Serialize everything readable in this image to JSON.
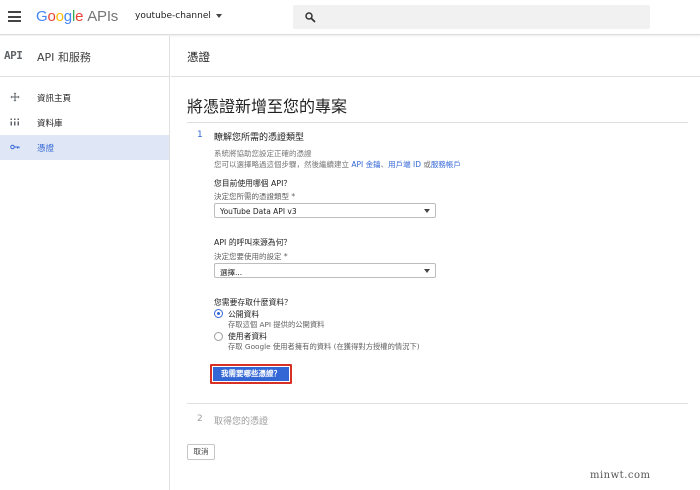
{
  "topbar": {
    "logo_letters": [
      "G",
      "o",
      "o",
      "g",
      "l",
      "e"
    ],
    "logo_suffix": "APIs",
    "project_name": "youtube-channel",
    "brand_colors": {
      "blue": "#4285f4",
      "red": "#ea4335",
      "yellow": "#fbbc05",
      "green": "#34a853"
    }
  },
  "sidebar": {
    "api_mark": "API",
    "title": "API 和服務",
    "items": [
      {
        "label": "資訊主頁",
        "icon": "dashboard-icon"
      },
      {
        "label": "資料庫",
        "icon": "library-icon"
      },
      {
        "label": "憑證",
        "icon": "key-icon",
        "active": true
      }
    ]
  },
  "main": {
    "header_title": "憑證",
    "heading": "將憑證新增至您的專案",
    "step1": {
      "number": "1",
      "title": "瞭解您所需的憑證類型",
      "desc_line1": "系統將協助您設定正確的憑證",
      "desc_line2_prefix": "您可以選擇略過這個步驟，然後繼續建立 ",
      "link_api_key": "API 金鑰",
      "sep1": "、",
      "link_oauth": "用戶端 ID",
      "sep2": " 或",
      "link_service": "服務帳戶",
      "q1": "您目前使用哪個 API？",
      "q1_hint": "決定您所需的憑證類型 *",
      "q1_value": "YouTube Data API v3",
      "q2": "API 的呼叫來源為何？",
      "q2_hint": "決定您要使用的設定 *",
      "q2_value": "選擇...",
      "q3": "您需要存取什麼資料？",
      "radio1_label": "公開資料",
      "radio1_sub": "存取這個 API 提供的公開資料",
      "radio2_label": "使用者資料",
      "radio2_sub": "存取 Google 使用者擁有的資料 (在獲得對方授權的情況下)",
      "cta_label": "我需要哪些憑證？"
    },
    "step2": {
      "number": "2",
      "title": "取得您的憑證"
    },
    "cancel_label": "取消"
  },
  "watermark": "minwt.com",
  "colors": {
    "accent": "#3367d6",
    "highlight_border": "#d93025",
    "active_bg": "#dfe6f5"
  }
}
